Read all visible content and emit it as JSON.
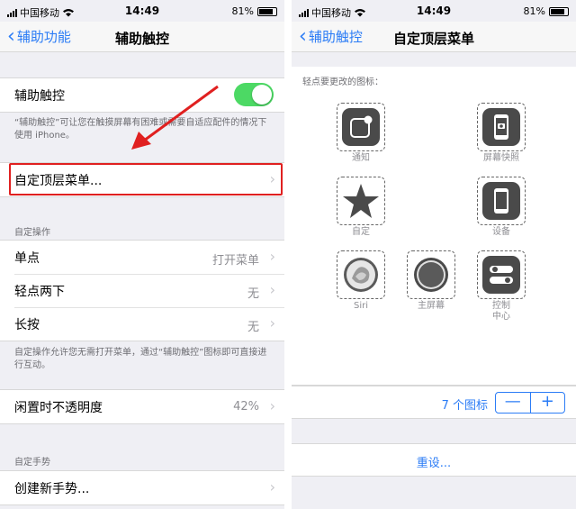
{
  "status": {
    "carrier": "中国移动",
    "time": "14:49",
    "battery": "81%",
    "battery_level": 0.81
  },
  "left": {
    "nav": {
      "back_label": "辅助功能",
      "title": "辅助触控"
    },
    "toggle_row": {
      "label": "辅助触控",
      "on": true
    },
    "toggle_note": "“辅助触控”可让您在触摸屏幕有困难或需要自适应配件的情况下使用 iPhone。",
    "custom_menu": {
      "label": "自定顶层菜单..."
    },
    "actions_header": "自定操作",
    "actions": [
      {
        "label": "单点",
        "value": "打开菜单"
      },
      {
        "label": "轻点两下",
        "value": "无"
      },
      {
        "label": "长按",
        "value": "无"
      }
    ],
    "actions_note": "自定操作允许您无需打开菜单，通过“辅助触控”图标即可直接进行互动。",
    "opacity": {
      "label": "闲置时不透明度",
      "value": "42%"
    },
    "gestures_header": "自定手势",
    "gesture": {
      "label": "创建新手势..."
    }
  },
  "right": {
    "nav": {
      "back_label": "辅助触控",
      "title": "自定顶层菜单"
    },
    "hint": "轻点要更改的图标：",
    "icons": {
      "notification": "通知",
      "screenshot": "屏幕快照",
      "custom": "自定",
      "device": "设备",
      "siri": "Siri",
      "home": "主屏幕",
      "control_l1": "控制",
      "control_l2": "中心"
    },
    "count_label": "7 个图标",
    "minus": "—",
    "plus": "+",
    "reset": "重设..."
  },
  "colors": {
    "accent": "#2b7cf6",
    "toggle_on": "#4cd964",
    "highlight": "#e02020"
  }
}
